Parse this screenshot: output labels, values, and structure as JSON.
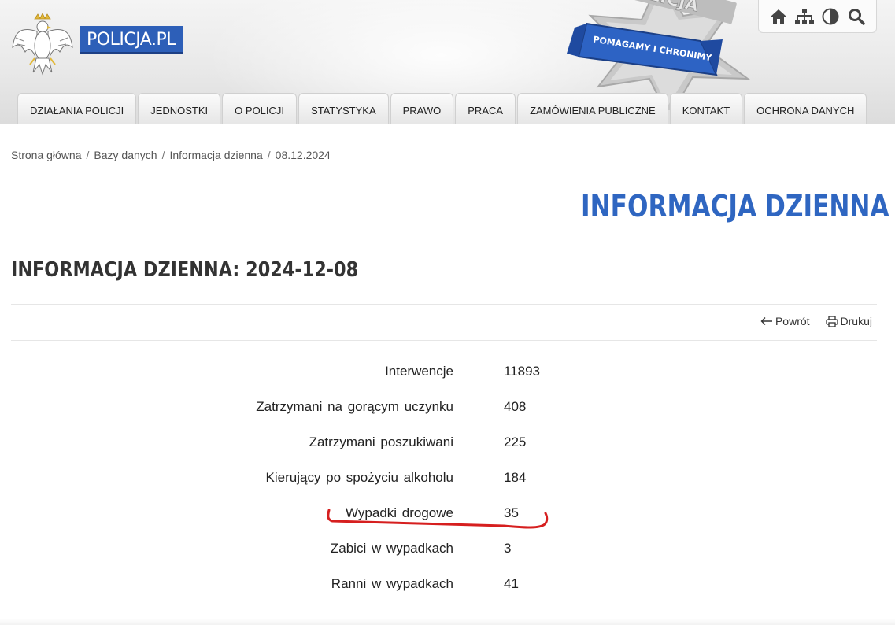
{
  "header": {
    "logo_text": "POLICJA.PL",
    "badge_text_top": "POLICJA",
    "badge_ribbon_text": "POMAGAMY I CHRONIMY",
    "tools": [
      {
        "name": "home-icon"
      },
      {
        "name": "sitemap-icon"
      },
      {
        "name": "contrast-icon"
      },
      {
        "name": "search-icon"
      }
    ]
  },
  "nav": {
    "items": [
      {
        "label": "DZIAŁANIA POLICJI"
      },
      {
        "label": "JEDNOSTKI"
      },
      {
        "label": "O POLICJI"
      },
      {
        "label": "STATYSTYKA"
      },
      {
        "label": "PRAWO"
      },
      {
        "label": "PRACA"
      },
      {
        "label": "ZAMÓWIENIA PUBLICZNE"
      },
      {
        "label": "KONTAKT"
      },
      {
        "label": "OCHRONA DANYCH"
      }
    ]
  },
  "breadcrumb": {
    "items": [
      {
        "label": "Strona główna"
      },
      {
        "label": "Bazy danych"
      },
      {
        "label": "Informacja dzienna"
      },
      {
        "label": "08.12.2024"
      }
    ],
    "separator": "/"
  },
  "page": {
    "title": "INFORMACJA DZIENNA",
    "subtitle": "INFORMACJA DZIENNA: 2024-12-08"
  },
  "actions": {
    "back_label": "Powrót",
    "print_label": "Drukuj"
  },
  "stats": [
    {
      "label": "Interwencje",
      "value": "11893"
    },
    {
      "label": "Zatrzymani na gorącym uczynku",
      "value": "408"
    },
    {
      "label": "Zatrzymani poszukiwani",
      "value": "225"
    },
    {
      "label": "Kierujący po spożyciu alkoholu",
      "value": "184"
    },
    {
      "label": "Wypadki drogowe",
      "value": "35"
    },
    {
      "label": "Zabici w wypadkach",
      "value": "3"
    },
    {
      "label": "Ranni w wypadkach",
      "value": "41"
    }
  ],
  "colors": {
    "accent": "#2f66c1",
    "logo_bg": "#2d5fb8",
    "highlight": "#d61f1f"
  }
}
